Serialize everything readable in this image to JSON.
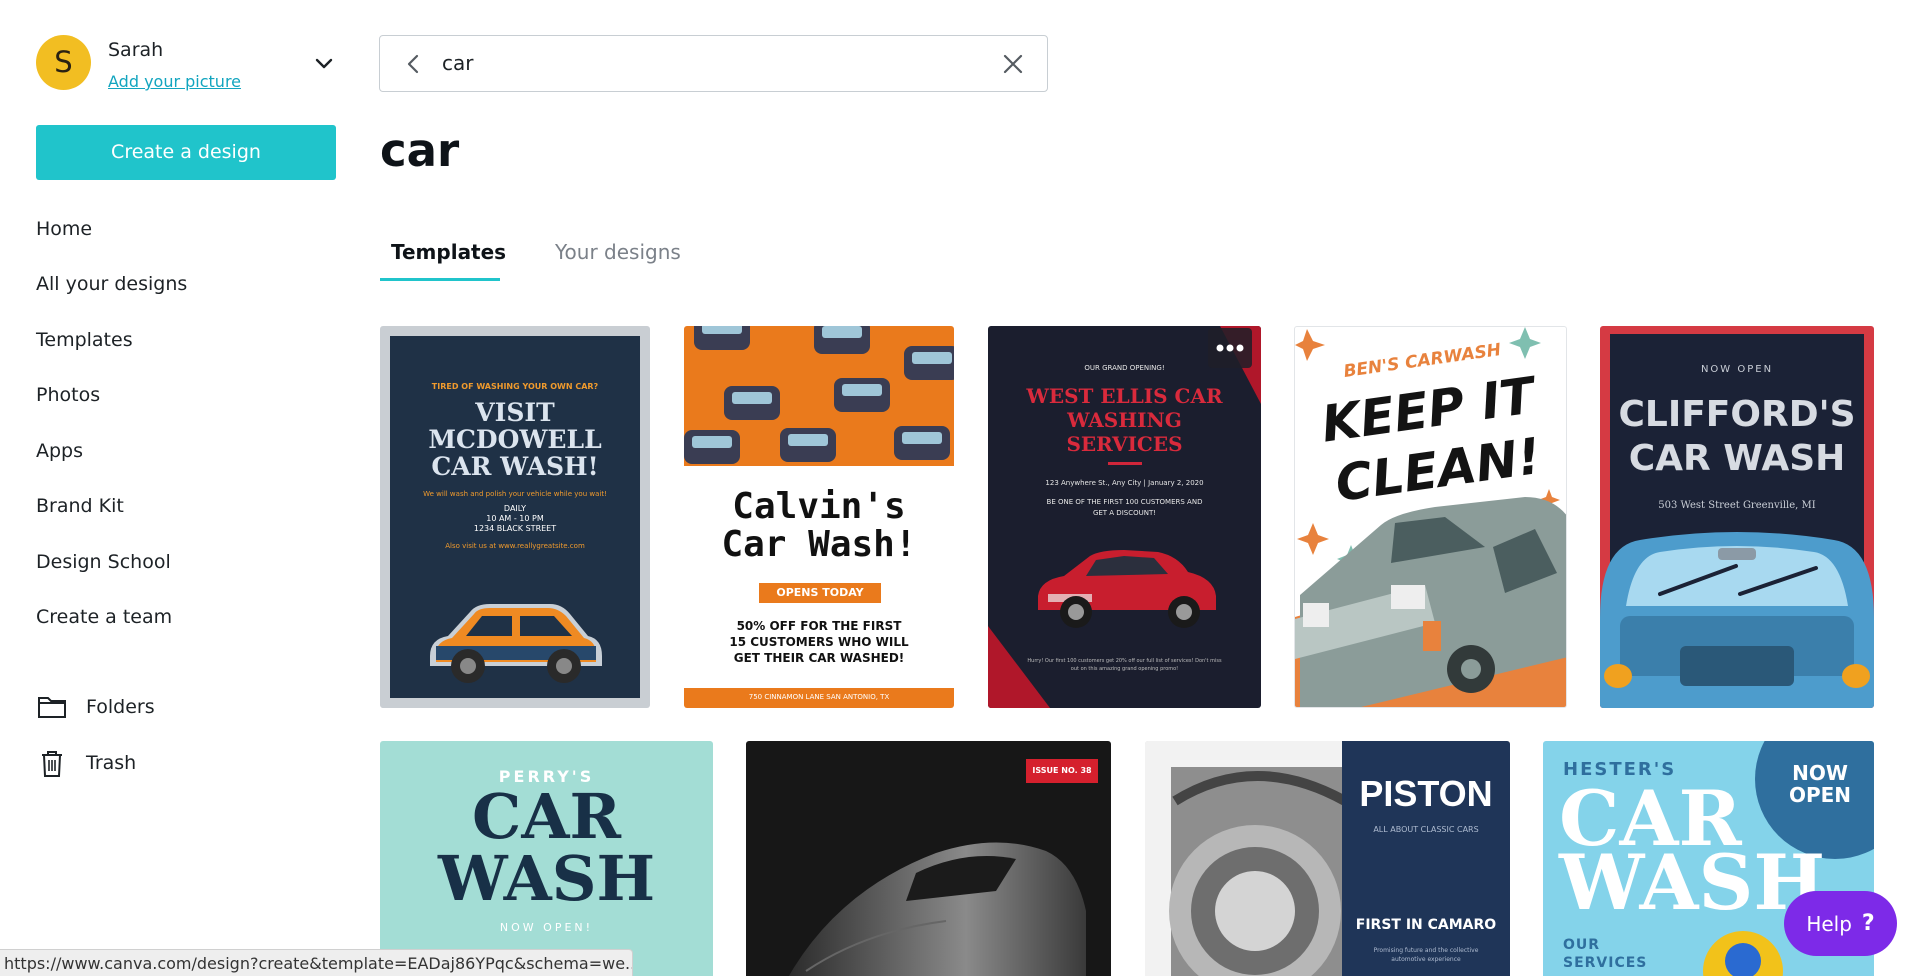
{
  "user": {
    "initial": "S",
    "name": "Sarah",
    "add_picture": "Add your picture",
    "avatar_color": "#f2be22"
  },
  "sidebar": {
    "create_label": "Create a design",
    "items": [
      {
        "label": "Home"
      },
      {
        "label": "All your designs"
      },
      {
        "label": "Templates"
      },
      {
        "label": "Photos"
      },
      {
        "label": "Apps"
      },
      {
        "label": "Brand Kit"
      },
      {
        "label": "Design School"
      },
      {
        "label": "Create a team"
      }
    ],
    "folders_label": "Folders",
    "trash_label": "Trash"
  },
  "search": {
    "value": "car"
  },
  "page_title": "car",
  "tabs": [
    {
      "label": "Templates",
      "active": true
    },
    {
      "label": "Your designs",
      "active": false
    }
  ],
  "templates": {
    "c1": {
      "kicker": "TIRED OF WASHING YOUR OWN CAR?",
      "title_1": "VISIT",
      "title_2": "MCDOWELL",
      "title_3": "CAR WASH!",
      "sub": "We will wash and polish your vehicle while you wait!",
      "daily": "DAILY",
      "hours": "10 AM - 10 PM",
      "street": "1234 BLACK STREET",
      "web": "Also visit us at www.reallygreatsite.com"
    },
    "c2": {
      "title_1": "Calvin's",
      "title_2": "Car Wash!",
      "badge": "OPENS TODAY",
      "offer_1": "50% OFF FOR THE FIRST",
      "offer_2": "15 CUSTOMERS WHO WILL",
      "offer_3": "GET THEIR CAR WASHED!",
      "address": "750 CINNAMON LANE SAN ANTONIO, TX"
    },
    "c3": {
      "kicker": "OUR GRAND OPENING!",
      "title_1": "WEST ELLIS CAR",
      "title_2": "WASHING",
      "title_3": "SERVICES",
      "address": "123 Anywhere St., Any City | January 2, 2020",
      "offer_1": "BE ONE OF THE FIRST 100 CUSTOMERS AND",
      "offer_2": "GET A DISCOUNT!",
      "fine_1": "Hurry! Our first 100 customers get 20% off our full list of services! Don't miss",
      "fine_2": "out on this amazing grand opening promo!"
    },
    "c4": {
      "brand": "BEN'S CARWASH",
      "title_1": "KEEP IT",
      "title_2": "CLEAN!"
    },
    "c5": {
      "kicker": "NOW OPEN",
      "title_1": "CLIFFORD'S",
      "title_2": "CAR WASH",
      "address": "503 West Street Greenville, MI"
    },
    "c6": {
      "kicker": "PERRY'S",
      "title_1": "CAR",
      "title_2": "WASH",
      "sub": "NOW OPEN!"
    },
    "c7": {
      "badge": "ISSUE NO. 38"
    },
    "c8": {
      "title": "PISTON",
      "sub": "ALL ABOUT CLASSIC CARS",
      "headline": "FIRST IN CAMARO",
      "fine_1": "Promising future and the collective",
      "fine_2": "automotive experience"
    },
    "c9": {
      "kicker": "HESTER'S",
      "badge_1": "NOW",
      "badge_2": "OPEN",
      "title_1": "CAR",
      "title_2": "WASH",
      "foot_1": "OUR",
      "foot_2": "SERVICES"
    }
  },
  "help": {
    "label": "Help",
    "icon_char": "?"
  },
  "status_url": "https://www.canva.com/design?create&template=EADaj86YPqc&schema=we...",
  "colors": {
    "accent": "#20c4cb",
    "help": "#7d2ae8",
    "link": "#12a5bf"
  }
}
